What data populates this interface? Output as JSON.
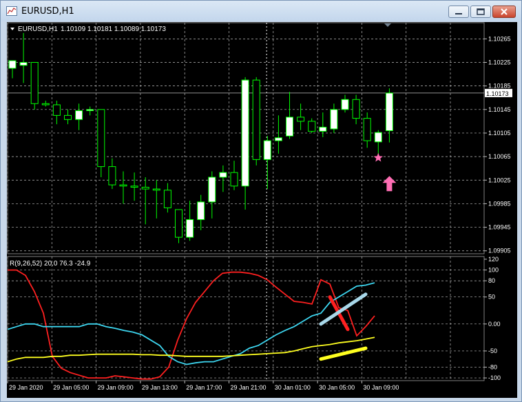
{
  "window": {
    "title": "EURUSD,H1"
  },
  "colors": {
    "background": "#000000",
    "grid": "#c0c0c0",
    "bull_candle": "#ffffff",
    "bear_candle": "#000000",
    "candle_outline": "#00ff00",
    "red_line": "#ff2020",
    "cyan_line": "#3dd6f0",
    "yellow_line": "#ffff20",
    "marker": "#ff6eb4",
    "text": "#ffffff"
  },
  "chart_data": [
    {
      "type": "candlestick",
      "title": "EURUSD,H1  1.10109 1.10181 1.10089 1.10173",
      "symbol": "EURUSD,H1",
      "ohlc_header": "1.10109 1.10181 1.10089 1.10173",
      "ylim": [
        1.099,
        1.1029
      ],
      "y_ticks": [
        "1.10265",
        "1.10225",
        "1.10185",
        "1.10145",
        "1.10105",
        "1.10065",
        "1.10025",
        "1.09985",
        "1.09945",
        "1.09905"
      ],
      "y_tick_values": [
        1.10265,
        1.10225,
        1.10185,
        1.10145,
        1.10105,
        1.10065,
        1.10025,
        1.09985,
        1.09945,
        1.09905
      ],
      "current_price": "1.10173",
      "grid": true,
      "candles": [
        {
          "o": 1.10215,
          "h": 1.10226,
          "l": 1.10198,
          "c": 1.10228
        },
        {
          "o": 1.1022,
          "h": 1.10275,
          "l": 1.1019,
          "c": 1.10225
        },
        {
          "o": 1.10225,
          "h": 1.10225,
          "l": 1.10145,
          "c": 1.10155
        },
        {
          "o": 1.10155,
          "h": 1.1016,
          "l": 1.1015,
          "c": 1.10153
        },
        {
          "o": 1.10153,
          "h": 1.1016,
          "l": 1.1012,
          "c": 1.10135
        },
        {
          "o": 1.10135,
          "h": 1.10145,
          "l": 1.1012,
          "c": 1.10128
        },
        {
          "o": 1.10128,
          "h": 1.10155,
          "l": 1.1011,
          "c": 1.10143
        },
        {
          "o": 1.10143,
          "h": 1.1015,
          "l": 1.10135,
          "c": 1.10145
        },
        {
          "o": 1.10145,
          "h": 1.10145,
          "l": 1.1003,
          "c": 1.10048
        },
        {
          "o": 1.10048,
          "h": 1.10062,
          "l": 1.1001,
          "c": 1.10017
        },
        {
          "o": 1.10017,
          "h": 1.1004,
          "l": 1.09985,
          "c": 1.10015
        },
        {
          "o": 1.10015,
          "h": 1.10038,
          "l": 1.0999,
          "c": 1.10013
        },
        {
          "o": 1.10013,
          "h": 1.1003,
          "l": 1.0995,
          "c": 1.1001
        },
        {
          "o": 1.1001,
          "h": 1.10025,
          "l": 1.0996,
          "c": 1.10008
        },
        {
          "o": 1.10008,
          "h": 1.1002,
          "l": 1.0997,
          "c": 1.09978
        },
        {
          "o": 1.09975,
          "h": 1.09975,
          "l": 1.09918,
          "c": 1.09928
        },
        {
          "o": 1.09928,
          "h": 1.0999,
          "l": 1.09922,
          "c": 1.09958
        },
        {
          "o": 1.09958,
          "h": 1.1,
          "l": 1.0994,
          "c": 1.09988
        },
        {
          "o": 1.09988,
          "h": 1.1004,
          "l": 1.0996,
          "c": 1.1003
        },
        {
          "o": 1.1003,
          "h": 1.1005,
          "l": 1.10005,
          "c": 1.10038
        },
        {
          "o": 1.10038,
          "h": 1.10058,
          "l": 1.10008,
          "c": 1.10015
        },
        {
          "o": 1.10015,
          "h": 1.102,
          "l": 1.09975,
          "c": 1.10195
        },
        {
          "o": 1.10195,
          "h": 1.102,
          "l": 1.1005,
          "c": 1.1006
        },
        {
          "o": 1.1006,
          "h": 1.101,
          "l": 1.1001,
          "c": 1.10092
        },
        {
          "o": 1.10092,
          "h": 1.10135,
          "l": 1.1007,
          "c": 1.10097
        },
        {
          "o": 1.101,
          "h": 1.10175,
          "l": 1.10095,
          "c": 1.10132
        },
        {
          "o": 1.10132,
          "h": 1.10155,
          "l": 1.1011,
          "c": 1.10125
        },
        {
          "o": 1.10125,
          "h": 1.1013,
          "l": 1.10105,
          "c": 1.10108
        },
        {
          "o": 1.10108,
          "h": 1.1014,
          "l": 1.10098,
          "c": 1.10115
        },
        {
          "o": 1.10112,
          "h": 1.10155,
          "l": 1.10105,
          "c": 1.10145
        },
        {
          "o": 1.10145,
          "h": 1.1017,
          "l": 1.1014,
          "c": 1.10162
        },
        {
          "o": 1.10162,
          "h": 1.1017,
          "l": 1.1012,
          "c": 1.1013
        },
        {
          "o": 1.1013,
          "h": 1.1014,
          "l": 1.1008,
          "c": 1.10092
        },
        {
          "o": 1.1009,
          "h": 1.1011,
          "l": 1.1006,
          "c": 1.10106
        },
        {
          "o": 1.10109,
          "h": 1.10181,
          "l": 1.10089,
          "c": 1.10173
        }
      ],
      "markers": [
        {
          "shape": "star",
          "bar": 33,
          "price": 1.10063
        },
        {
          "shape": "up-arrow",
          "bar": 34,
          "price": 1.10018
        }
      ]
    },
    {
      "type": "line",
      "title": "R(9,26,52) 20.0 76.3 -24.9",
      "label": "R(9,26,52) 20.0 76.3 -24.9",
      "ylim": [
        -105,
        125
      ],
      "y_ticks": [
        "120",
        "100",
        "80",
        "50",
        "0.00",
        "-50",
        "-80",
        "-100"
      ],
      "y_tick_values": [
        120,
        100,
        80,
        50,
        0,
        -50,
        -80,
        -100
      ],
      "series": [
        {
          "color": "#ff2020",
          "values": [
            100,
            100,
            90,
            60,
            20,
            -60,
            -82,
            -90,
            -95,
            -100,
            -100,
            -100,
            -96,
            -98,
            -100,
            -102,
            -102,
            -98,
            -80,
            -30,
            10,
            40,
            60,
            80,
            94,
            96,
            96,
            94,
            90,
            82,
            68,
            55,
            42,
            40,
            37,
            82,
            74,
            30,
            25,
            -22,
            -5,
            15
          ]
        },
        {
          "color": "#3dd6f0",
          "values": [
            -10,
            -5,
            0,
            0,
            -5,
            -5,
            -5,
            -5,
            -5,
            0,
            0,
            -5,
            -8,
            -12,
            -15,
            -20,
            -30,
            -40,
            -60,
            -70,
            -75,
            -72,
            -70,
            -70,
            -65,
            -60,
            -55,
            -45,
            -40,
            -30,
            -20,
            -12,
            -5,
            5,
            15,
            20,
            40,
            50,
            60,
            70,
            72,
            76.3
          ]
        },
        {
          "color": "#ffff20",
          "values": [
            -70,
            -65,
            -62,
            -62,
            -62,
            -60,
            -60,
            -58,
            -58,
            -57,
            -56,
            -56,
            -56,
            -56,
            -56,
            -57,
            -57,
            -58,
            -58,
            -59,
            -60,
            -60,
            -60,
            -60,
            -60,
            -59,
            -58,
            -57,
            -56,
            -55,
            -54,
            -53,
            -50,
            -46,
            -42,
            -40,
            -38,
            -35,
            -33,
            -31,
            -28,
            -24.9
          ]
        }
      ]
    }
  ],
  "x_axis": {
    "labels": [
      "29 Jan 2020",
      "29 Jan 05:00",
      "29 Jan 09:00",
      "29 Jan 13:00",
      "29 Jan 17:00",
      "29 Jan 21:00",
      "30 Jan 01:00",
      "30 Jan 05:00",
      "30 Jan 09:00"
    ]
  },
  "annotations": {
    "bars": [
      {
        "color": "#ff2020",
        "from": [
          36,
          50
        ],
        "to": [
          38,
          -10
        ]
      },
      {
        "color": "#a8d8ea",
        "from": [
          35,
          0
        ],
        "to": [
          40,
          55
        ]
      },
      {
        "color": "#ffff20",
        "from": [
          35,
          -65
        ],
        "to": [
          40,
          -45
        ]
      }
    ]
  }
}
